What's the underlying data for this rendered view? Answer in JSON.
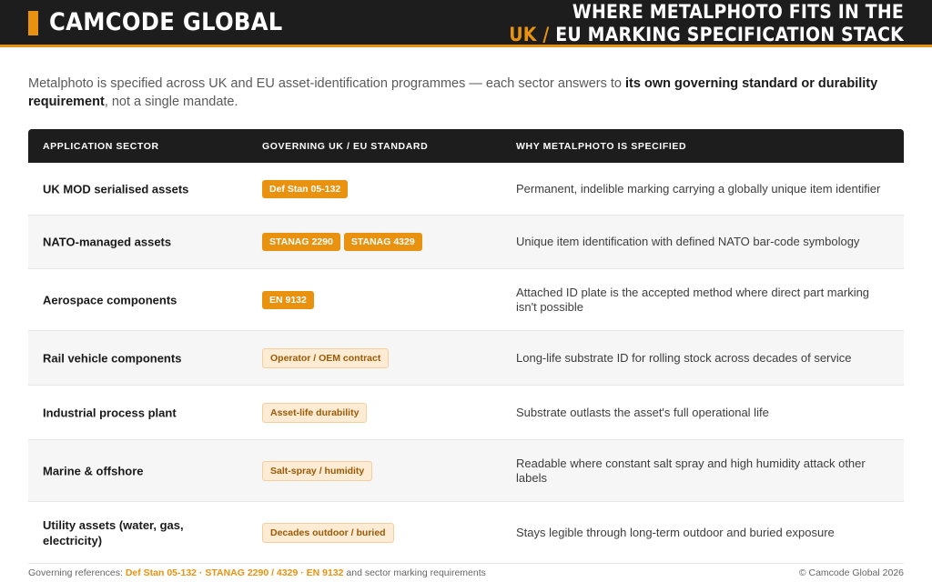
{
  "header": {
    "brand": "CAMCODE GLOBAL",
    "title_line1": "WHERE METALPHOTO FITS IN THE",
    "title_line2_accent": "UK /",
    "title_line2_rest": " EU MARKING SPECIFICATION STACK",
    "colors": {
      "background": "#1d1d1d",
      "accent": "#e8920f"
    }
  },
  "intro": {
    "lead": "Metalphoto is specified across UK and EU asset-identification programmes — each sector answers to ",
    "bold": "its own governing standard or durability requirement",
    "tail": ", not a single mandate."
  },
  "table": {
    "headers": [
      "APPLICATION SECTOR",
      "GOVERNING UK / EU STANDARD",
      "WHY METALPHOTO IS SPECIFIED"
    ],
    "rows": [
      {
        "sector": "UK MOD serialised assets",
        "tags": [
          "Def Stan 05-132"
        ],
        "tag_style": "solid",
        "why": "Permanent, indelible marking carrying a globally unique item identifier"
      },
      {
        "sector": "NATO-managed assets",
        "tags": [
          "STANAG 2290",
          "STANAG 4329"
        ],
        "tag_style": "solid",
        "why": "Unique item identification with defined NATO bar-code symbology"
      },
      {
        "sector": "Aerospace components",
        "tags": [
          "EN 9132"
        ],
        "tag_style": "solid",
        "why": "Attached ID plate is the accepted method where direct part marking isn't possible"
      },
      {
        "sector": "Rail vehicle components",
        "tags": [
          "Operator / OEM contract"
        ],
        "tag_style": "soft",
        "why": "Long-life substrate ID for rolling stock across decades of service"
      },
      {
        "sector": "Industrial process plant",
        "tags": [
          "Asset-life durability"
        ],
        "tag_style": "soft",
        "why": "Substrate outlasts the asset's full operational life"
      },
      {
        "sector": "Marine & offshore",
        "tags": [
          "Salt-spray / humidity"
        ],
        "tag_style": "soft",
        "why": "Readable where constant salt spray and high humidity attack other labels"
      },
      {
        "sector": "Utility assets (water, gas, electricity)",
        "tags": [
          "Decades outdoor / buried"
        ],
        "tag_style": "soft",
        "why": "Stays legible through long-term outdoor and buried exposure"
      }
    ]
  },
  "footer": {
    "prefix": "Governing references: ",
    "refs": "Def Stan 05-132 · STANAG 2290 / 4329 · EN 9132",
    "suffix": " and sector marking requirements",
    "copyright": "© Camcode Global 2026"
  }
}
